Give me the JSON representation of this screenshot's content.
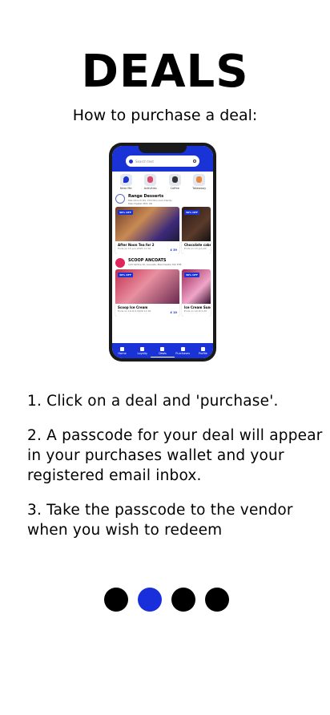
{
  "page": {
    "title": "DEALS",
    "subtitle": "How to purchase a deal:"
  },
  "phone": {
    "search_placeholder": "Search text",
    "categories": [
      {
        "label": "Near Me",
        "icon": "map-pin-icon"
      },
      {
        "label": "Activities",
        "icon": "activities-icon"
      },
      {
        "label": "Coffee",
        "icon": "coffee-icon"
      },
      {
        "label": "Takeaway",
        "icon": "takeaway-icon"
      }
    ],
    "vendors": [
      {
        "name": "Range Desserts",
        "address": "60s Church Rd, Chorlton-cum-Hardy, Manchester M21 0D",
        "deals": [
          {
            "badge": "30% OFF",
            "name": "After Noon Tea for 2",
            "ends": "Ends on 15-Jun-2026 11:30",
            "price": "£ 39"
          },
          {
            "badge": "30% OFF",
            "name": "Chocolate cake",
            "ends": "Ends on 15-Jun-20",
            "price": ""
          }
        ]
      },
      {
        "name": "SCOOP ANCOATS",
        "address": "120 Sillitoe St, Ancoats, Manchester M4 5TB",
        "deals": [
          {
            "badge": "30% OFF",
            "name": "Scoop Ice Cream",
            "ends": "Ends on 16-Oct-2026 11:30",
            "price": "£ 10"
          },
          {
            "badge": "30% OFF",
            "name": "Ice Cream Sunday",
            "ends": "Ends on 16-Oct-20",
            "price": ""
          }
        ]
      }
    ],
    "tabs": [
      {
        "label": "Home",
        "icon": "home-icon"
      },
      {
        "label": "Loyalty",
        "icon": "loyalty-icon"
      },
      {
        "label": "Deals",
        "icon": "deals-icon"
      },
      {
        "label": "Purchases",
        "icon": "purchases-icon"
      },
      {
        "label": "Profile",
        "icon": "profile-icon"
      }
    ]
  },
  "steps": [
    "1. Click on a deal and 'purchase'.",
    "2. A passcode for your deal will appear in your purchases wallet and your registered email inbox.",
    "3. Take the passcode to the vendor when you wish to redeem"
  ],
  "pagination": {
    "total": 4,
    "active_index": 1,
    "colors": {
      "inactive": "#000000",
      "active": "#1a2fdc"
    }
  }
}
